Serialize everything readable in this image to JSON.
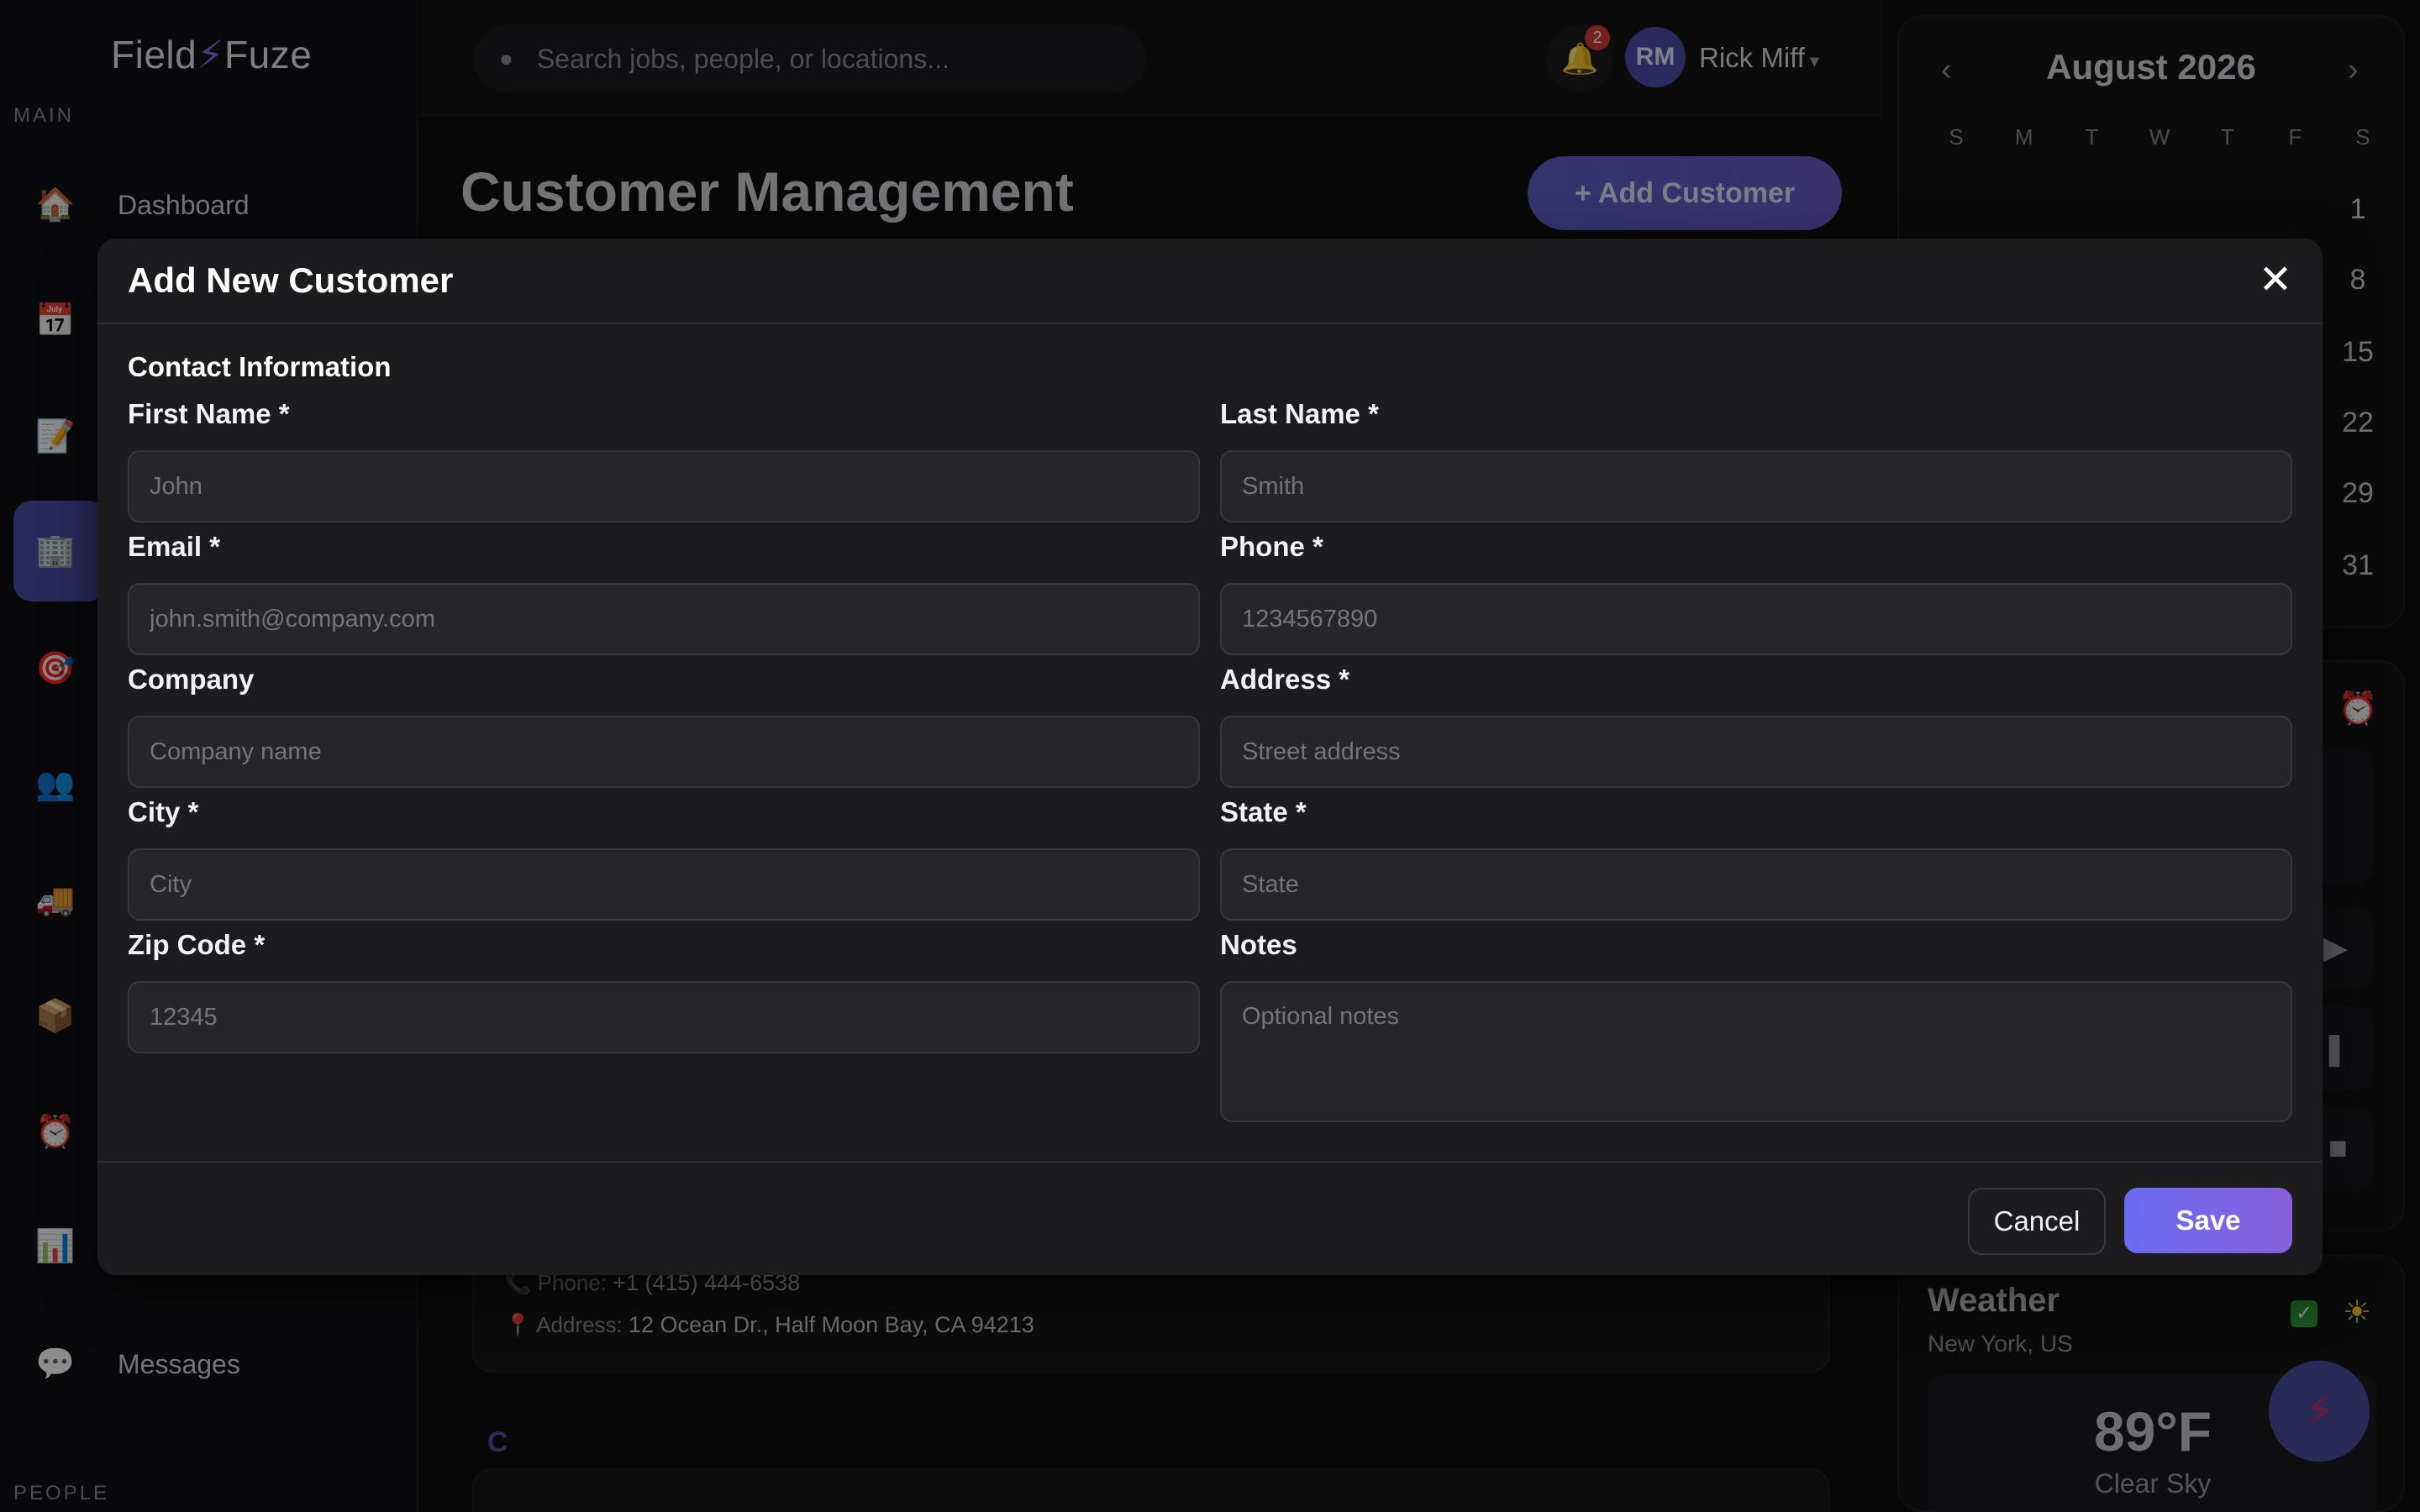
{
  "app": {
    "logo_left": "Field",
    "logo_bolt": "⚡",
    "logo_right": "Fuze"
  },
  "sidebar": {
    "section_main": "MAIN",
    "section_people": "PEOPLE",
    "items": [
      {
        "icon": "🏠",
        "label": "Dashboard"
      },
      {
        "icon": "📅",
        "label": ""
      },
      {
        "icon": "📝",
        "label": ""
      },
      {
        "icon": "🏢",
        "label": ""
      },
      {
        "icon": "🎯",
        "label": ""
      },
      {
        "icon": "👥",
        "label": ""
      },
      {
        "icon": "🚚",
        "label": ""
      },
      {
        "icon": "📦",
        "label": ""
      },
      {
        "icon": "⏰",
        "label": ""
      },
      {
        "icon": "📊",
        "label": ""
      },
      {
        "icon": "💬",
        "label": "Messages"
      }
    ]
  },
  "topbar": {
    "search_placeholder": "Search jobs, people, or locations...",
    "notification_count": "2",
    "avatar_initials": "RM",
    "user_name": "Rick Miff",
    "caret": "▾"
  },
  "page": {
    "title": "Customer Management",
    "add_button": "+ Add Customer"
  },
  "background_card": {
    "phone_label": "Phone:",
    "phone_value": "+1 (415) 444-6538",
    "address_label": "Address:",
    "address_value": "12 Ocean Dr., Half Moon Bay, CA 94213",
    "section_letter": "C"
  },
  "calendar": {
    "title": "August 2026",
    "prev": "‹",
    "next": "›",
    "dows": [
      "S",
      "M",
      "T",
      "W",
      "T",
      "F",
      "S"
    ],
    "saturday_days": [
      "1",
      "8",
      "15",
      "22",
      "29",
      "31"
    ]
  },
  "weather": {
    "title": "Weather",
    "location": "New York, US",
    "temperature": "89°F",
    "condition": "Clear Sky"
  },
  "modal": {
    "title": "Add New Customer",
    "close": "✕",
    "section": "Contact Information",
    "fields": {
      "first_name": {
        "label": "First Name *",
        "placeholder": "John"
      },
      "last_name": {
        "label": "Last Name *",
        "placeholder": "Smith"
      },
      "email": {
        "label": "Email *",
        "placeholder": "john.smith@company.com"
      },
      "phone": {
        "label": "Phone *",
        "placeholder": "1234567890"
      },
      "company": {
        "label": "Company",
        "placeholder": "Company name"
      },
      "address": {
        "label": "Address *",
        "placeholder": "Street address"
      },
      "city": {
        "label": "City *",
        "placeholder": "City"
      },
      "state": {
        "label": "State *",
        "placeholder": "State"
      },
      "zip": {
        "label": "Zip Code *",
        "placeholder": "12345"
      },
      "notes": {
        "label": "Notes",
        "placeholder": "Optional notes"
      }
    },
    "cancel": "Cancel",
    "save": "Save"
  },
  "colors": {
    "accent": "#6a6cf1",
    "accent_end": "#8860dc",
    "modal_bg": "#1c1c1f",
    "input_bg": "#262629"
  }
}
